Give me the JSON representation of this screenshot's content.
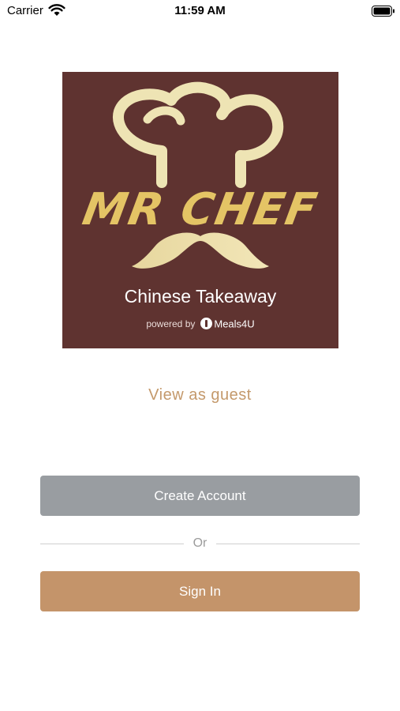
{
  "status_bar": {
    "carrier": "Carrier",
    "time": "11:59 AM",
    "battery_level": 1.0
  },
  "logo": {
    "brand": "MR CHEF",
    "tagline": "Chinese Takeaway",
    "powered_by": "powered by",
    "platform": "Meals4U",
    "background_color": "#5f3330",
    "gold_color": "#e4c465"
  },
  "guest_link": {
    "label": "View as guest",
    "color": "#c4996b"
  },
  "create_account": {
    "label": "Create Account",
    "color": "#999da1"
  },
  "divider": {
    "label": "Or"
  },
  "sign_in": {
    "label": "Sign In",
    "color": "#c4946a"
  }
}
